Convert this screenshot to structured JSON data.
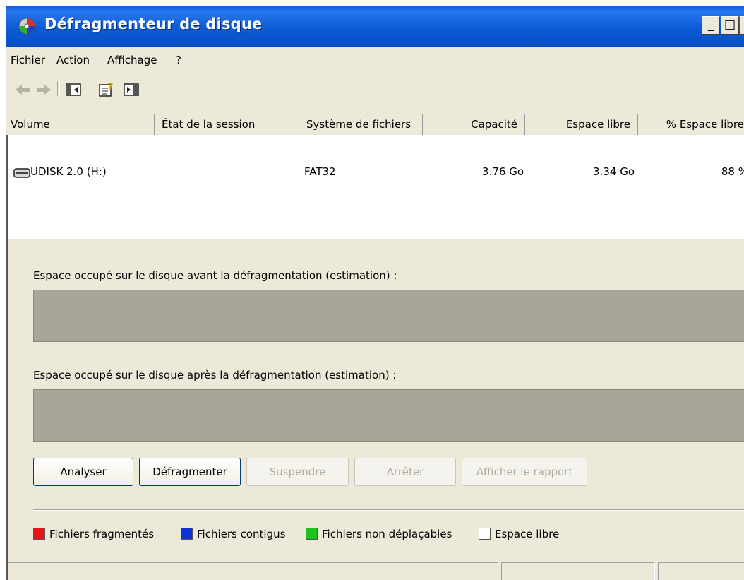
{
  "window": {
    "title": "Défragmenteur de disque",
    "controls": {
      "minimize": "_",
      "maximize": "□",
      "close": "×"
    }
  },
  "menu": [
    "Fichier",
    "Action",
    "Affichage",
    "?"
  ],
  "toolbar": {
    "icons": [
      "back-arrow-icon",
      "forward-arrow-icon",
      "show-hide-console-tree-icon",
      "help-icon",
      "show-hide-action-pane-icon"
    ]
  },
  "columns": [
    "Volume",
    "État de la session",
    "Système de fichiers",
    "Capacité",
    "Espace libre",
    "% Espace libre"
  ],
  "volumes": [
    {
      "name": "UDISK 2.0 (H:)",
      "session_state": "",
      "filesystem": "FAT32",
      "capacity": "3.76 Go",
      "free_space": "3.34 Go",
      "percent_free": "88 %",
      "icon": "removable-drive-icon"
    }
  ],
  "analysis": {
    "before_label": "Espace occupé sur le disque avant la défragmentation (estimation) :",
    "after_label": "Espace occupé sur le disque après la défragmentation (estimation) :",
    "bar_color": "#a8a599"
  },
  "buttons": {
    "analyze": "Analyser",
    "defragment": "Défragmenter",
    "pause": "Suspendre",
    "stop": "Arrêter",
    "view_report": "Afficher le rapport"
  },
  "legend": [
    {
      "label": "Fichiers fragmentés",
      "color": "#e8141a"
    },
    {
      "label": "Fichiers contigus",
      "color": "#1030d8"
    },
    {
      "label": "Fichiers non déplaçables",
      "color": "#20c020"
    },
    {
      "label": "Espace libre",
      "color": "#ffffff"
    }
  ]
}
